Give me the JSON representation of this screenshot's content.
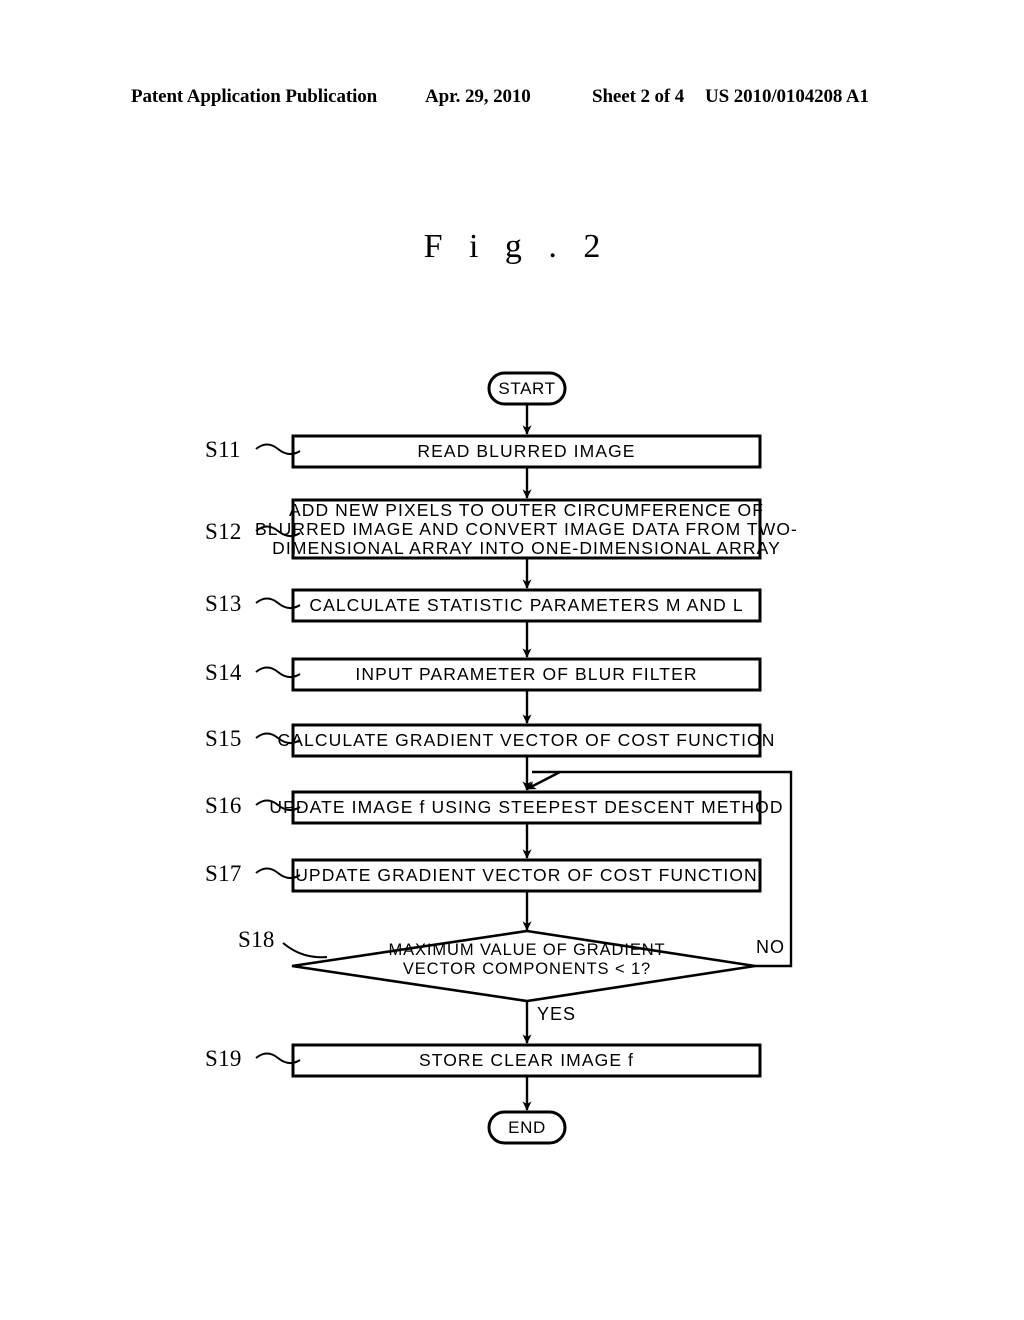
{
  "header": {
    "publication": "Patent Application Publication",
    "date": "Apr. 29, 2010",
    "sheet": "Sheet 2 of 4",
    "patent_number": "US 2010/0104208 A1"
  },
  "figure": {
    "title": "F i g .  2"
  },
  "flowchart": {
    "start_label": "START",
    "end_label": "END",
    "yes_label": "YES",
    "no_label": "NO",
    "steps": [
      {
        "ref": "S11",
        "shape": "process",
        "lines": [
          "READ BLURRED IMAGE"
        ]
      },
      {
        "ref": "S12",
        "shape": "process",
        "lines": [
          "ADD NEW PIXELS TO OUTER CIRCUMFERENCE OF",
          "BLURRED IMAGE AND CONVERT IMAGE DATA FROM TWO-",
          "DIMENSIONAL ARRAY INTO ONE-DIMENSIONAL ARRAY"
        ]
      },
      {
        "ref": "S13",
        "shape": "process",
        "lines": [
          "CALCULATE STATISTIC PARAMETERS M AND L"
        ]
      },
      {
        "ref": "S14",
        "shape": "process",
        "lines": [
          "INPUT PARAMETER OF BLUR FILTER"
        ]
      },
      {
        "ref": "S15",
        "shape": "process",
        "lines": [
          "CALCULATE GRADIENT VECTOR OF COST FUNCTION"
        ]
      },
      {
        "ref": "S16",
        "shape": "process",
        "lines": [
          "UPDATE IMAGE f USING STEEPEST DESCENT METHOD"
        ]
      },
      {
        "ref": "S17",
        "shape": "process",
        "lines": [
          "UPDATE GRADIENT VECTOR OF COST FUNCTION"
        ]
      },
      {
        "ref": "S18",
        "shape": "decision",
        "lines": [
          "MAXIMUM VALUE OF GRADIENT",
          "VECTOR COMPONENTS < 1?"
        ]
      },
      {
        "ref": "S19",
        "shape": "process",
        "lines": [
          "STORE CLEAR IMAGE f"
        ]
      }
    ]
  },
  "colors": {
    "ink": "#000000",
    "paper": "#ffffff"
  }
}
